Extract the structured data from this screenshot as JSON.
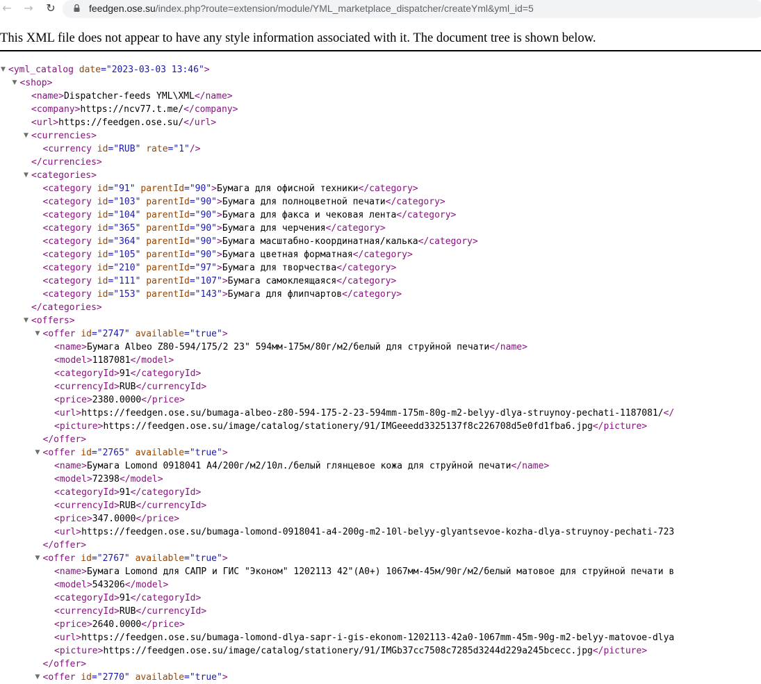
{
  "browser": {
    "url_host": "feedgen.ose.su",
    "url_rest": "/index.php?route=extension/module/YML_marketplace_dispatcher/createYml&yml_id=5",
    "back_icon": "arrow-left-icon",
    "forward_icon": "arrow-right-icon",
    "reload_icon": "reload-icon",
    "lock_icon": "lock-icon"
  },
  "notice": "This XML file does not appear to have any style information associated with it. The document tree is shown below.",
  "colors": {
    "tag": "#881280",
    "attr_name": "#994500",
    "attr_value": "#1a1aa6",
    "text": "#000000"
  },
  "tree": [
    {
      "d": 0,
      "c": true,
      "p": [
        "<yml_catalog",
        " date",
        "=\"2023-03-03 13:46\"",
        ">"
      ]
    },
    {
      "d": 1,
      "c": true,
      "p": [
        "<shop>"
      ]
    },
    {
      "d": 2,
      "p": [
        "<name>",
        "Dispatcher-feeds YML\\XML",
        "</name>"
      ]
    },
    {
      "d": 2,
      "p": [
        "<company>",
        "https://ncv77.t.me/",
        "</company>"
      ]
    },
    {
      "d": 2,
      "p": [
        "<url>",
        "https://feedgen.ose.su/",
        "</url>"
      ]
    },
    {
      "d": 2,
      "c": true,
      "p": [
        "<currencies>"
      ]
    },
    {
      "d": 3,
      "p": [
        "<currency",
        " id",
        "=\"RUB\"",
        " rate",
        "=\"1\"",
        "/>"
      ]
    },
    {
      "d": 2,
      "p": [
        "</currencies>"
      ]
    },
    {
      "d": 2,
      "c": true,
      "p": [
        "<categories>"
      ]
    },
    {
      "d": 3,
      "p": [
        "<category",
        " id",
        "=\"91\"",
        " parentId",
        "=\"90\"",
        ">",
        "Бумага для офисной техники",
        "</category>"
      ]
    },
    {
      "d": 3,
      "p": [
        "<category",
        " id",
        "=\"103\"",
        " parentId",
        "=\"90\"",
        ">",
        "Бумага для полноцветной печати",
        "</category>"
      ]
    },
    {
      "d": 3,
      "p": [
        "<category",
        " id",
        "=\"104\"",
        " parentId",
        "=\"90\"",
        ">",
        "Бумага для факса и чековая лента",
        "</category>"
      ]
    },
    {
      "d": 3,
      "p": [
        "<category",
        " id",
        "=\"365\"",
        " parentId",
        "=\"90\"",
        ">",
        "Бумага для черчения",
        "</category>"
      ]
    },
    {
      "d": 3,
      "p": [
        "<category",
        " id",
        "=\"364\"",
        " parentId",
        "=\"90\"",
        ">",
        "Бумага масштабно-координатная/калька",
        "</category>"
      ]
    },
    {
      "d": 3,
      "p": [
        "<category",
        " id",
        "=\"105\"",
        " parentId",
        "=\"90\"",
        ">",
        "Бумага цветная форматная",
        "</category>"
      ]
    },
    {
      "d": 3,
      "p": [
        "<category",
        " id",
        "=\"210\"",
        " parentId",
        "=\"97\"",
        ">",
        "Бумага для творчества",
        "</category>"
      ]
    },
    {
      "d": 3,
      "p": [
        "<category",
        " id",
        "=\"111\"",
        " parentId",
        "=\"107\"",
        ">",
        "Бумага самоклеящаяся",
        "</category>"
      ]
    },
    {
      "d": 3,
      "p": [
        "<category",
        " id",
        "=\"153\"",
        " parentId",
        "=\"143\"",
        ">",
        "Бумага для флипчартов",
        "</category>"
      ]
    },
    {
      "d": 2,
      "p": [
        "</categories>"
      ]
    },
    {
      "d": 2,
      "c": true,
      "p": [
        "<offers>"
      ]
    },
    {
      "d": 3,
      "c": true,
      "p": [
        "<offer",
        " id",
        "=\"2747\"",
        " available",
        "=\"true\"",
        ">"
      ]
    },
    {
      "d": 4,
      "p": [
        "<name>",
        "Бумага Albeo Z80-594/175/2 23\" 594мм-175м/80г/м2/белый для струйной печати",
        "</name>"
      ]
    },
    {
      "d": 4,
      "p": [
        "<model>",
        "1187081",
        "</model>"
      ]
    },
    {
      "d": 4,
      "p": [
        "<categoryId>",
        "91",
        "</categoryId>"
      ]
    },
    {
      "d": 4,
      "p": [
        "<currencyId>",
        "RUB",
        "</currencyId>"
      ]
    },
    {
      "d": 4,
      "p": [
        "<price>",
        "2380.0000",
        "</price>"
      ]
    },
    {
      "d": 4,
      "p": [
        "<url>",
        "https://feedgen.ose.su/bumaga-albeo-z80-594-175-2-23-594mm-175m-80g-m2-belyy-dlya-struynoy-pechati-1187081/",
        "</"
      ]
    },
    {
      "d": 4,
      "p": [
        "<picture>",
        "https://feedgen.ose.su/image/catalog/stationery/91/IMGeeedd3325137f8c226708d5e0fd1fba6.jpg",
        "</picture>"
      ]
    },
    {
      "d": 3,
      "p": [
        "</offer>"
      ]
    },
    {
      "d": 3,
      "c": true,
      "p": [
        "<offer",
        " id",
        "=\"2765\"",
        " available",
        "=\"true\"",
        ">"
      ]
    },
    {
      "d": 4,
      "p": [
        "<name>",
        "Бумага Lomond 0918041 A4/200г/м2/10л./белый глянцевое кожа для струйной печати",
        "</name>"
      ]
    },
    {
      "d": 4,
      "p": [
        "<model>",
        "72398",
        "</model>"
      ]
    },
    {
      "d": 4,
      "p": [
        "<categoryId>",
        "91",
        "</categoryId>"
      ]
    },
    {
      "d": 4,
      "p": [
        "<currencyId>",
        "RUB",
        "</currencyId>"
      ]
    },
    {
      "d": 4,
      "p": [
        "<price>",
        "347.0000",
        "</price>"
      ]
    },
    {
      "d": 4,
      "p": [
        "<url>",
        "https://feedgen.ose.su/bumaga-lomond-0918041-a4-200g-m2-10l-belyy-glyantsevoe-kozha-dlya-struynoy-pechati-723"
      ]
    },
    {
      "d": 3,
      "p": [
        "</offer>"
      ]
    },
    {
      "d": 3,
      "c": true,
      "p": [
        "<offer",
        " id",
        "=\"2767\"",
        " available",
        "=\"true\"",
        ">"
      ]
    },
    {
      "d": 4,
      "p": [
        "<name>",
        "Бумага Lomond для САПР и ГИС \"Эконом\" 1202113 42\"(A0+) 1067мм-45м/90г/м2/белый матовое для струйной печати в"
      ]
    },
    {
      "d": 4,
      "p": [
        "<model>",
        "543206",
        "</model>"
      ]
    },
    {
      "d": 4,
      "p": [
        "<categoryId>",
        "91",
        "</categoryId>"
      ]
    },
    {
      "d": 4,
      "p": [
        "<currencyId>",
        "RUB",
        "</currencyId>"
      ]
    },
    {
      "d": 4,
      "p": [
        "<price>",
        "2640.0000",
        "</price>"
      ]
    },
    {
      "d": 4,
      "p": [
        "<url>",
        "https://feedgen.ose.su/bumaga-lomond-dlya-sapr-i-gis-ekonom-1202113-42a0-1067mm-45m-90g-m2-belyy-matovoe-dlya"
      ]
    },
    {
      "d": 4,
      "p": [
        "<picture>",
        "https://feedgen.ose.su/image/catalog/stationery/91/IMGb37cc7508c7285d3244d229a245bcecc.jpg",
        "</picture>"
      ]
    },
    {
      "d": 3,
      "p": [
        "</offer>"
      ]
    },
    {
      "d": 3,
      "c": true,
      "p": [
        "<offer",
        " id",
        "=\"2770\"",
        " available",
        "=\"true\"",
        ">"
      ]
    }
  ]
}
